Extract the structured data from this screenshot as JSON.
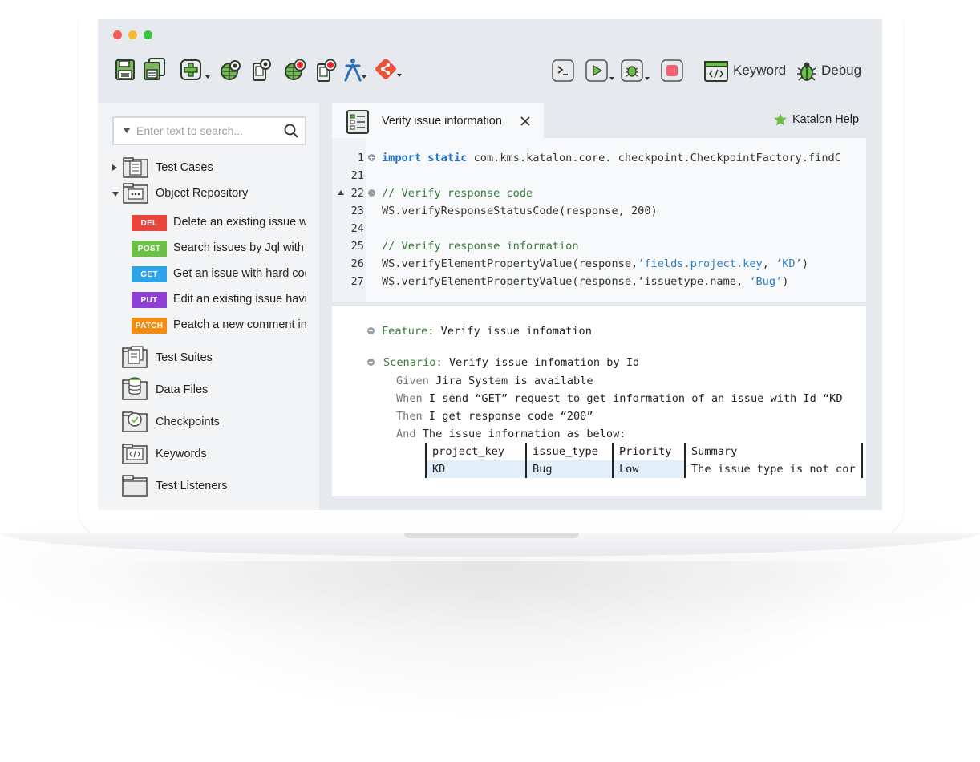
{
  "toolbar": {
    "keyword_label": "Keyword",
    "debug_label": "Debug"
  },
  "sidebar": {
    "search_placeholder": "Enter text to search...",
    "test_cases": "Test Cases",
    "object_repository": "Object Repository",
    "requests": [
      {
        "method": "DEL",
        "color": "#e8453c",
        "label": "Delete an existing issue wi"
      },
      {
        "method": "POST",
        "color": "#6cbf47",
        "label": "Search issues by Jql with"
      },
      {
        "method": "GET",
        "color": "#2ea3e8",
        "label": "Get an issue with hard cod"
      },
      {
        "method": "PUT",
        "color": "#8e3fd6",
        "label": "Edit an existing issue havir"
      },
      {
        "method": "PATCH",
        "color": "#f28c13",
        "label": "Peatch a new comment int"
      }
    ],
    "test_suites": "Test Suites",
    "data_files": "Data Files",
    "checkpoints": "Checkpoints",
    "keywords": "Keywords",
    "test_listeners": "Test Listeners"
  },
  "tab": {
    "title": "Verify issue information"
  },
  "help": {
    "label": "Katalon Help"
  },
  "code": {
    "line_numbers": [
      "1",
      "21",
      "22",
      "23",
      "24",
      "25",
      "26",
      "27"
    ],
    "l1_kw1": "import",
    "l1_kw2": "static",
    "l1_rest": " com.kms.katalon.core. checkpoint.CheckpointFactory.findC",
    "l22": "// Verify response code",
    "l23": "WS.verifyResponseStatusCode(response, 200)",
    "l25": "// Verify response information",
    "l26_a": "WS.verifyElementPropertyValue(response,",
    "l26_b": "’fields.project.key",
    "l26_c": ", ",
    "l26_d": "‘KD’",
    "l26_e": ")",
    "l27_a": "WS.verifyElementPropertyValue(response,’issuetype.name, ",
    "l27_b": "‘Bug’",
    "l27_c": ")"
  },
  "gherkin": {
    "feature_kw": "Feature:",
    "feature_text": " Verify issue infomation",
    "scenario_kw": "Scenario:",
    "scenario_text": " Verify issue infomation by Id",
    "given_kw": "Given",
    "given_text": " Jira System is available",
    "when_kw": "When",
    "when_text": " I send “GET” request to get information of an issue with Id “KD",
    "then_kw": "Then",
    "then_text": " I get response code “200”",
    "and_kw": "And",
    "and_text": " The issue information as below:",
    "table_header": [
      "project_key",
      "issue_type",
      "Priority",
      "Summary"
    ],
    "table_row": [
      "KD",
      "Bug",
      "Low",
      "The issue type is not cor"
    ]
  },
  "colors": {
    "accent_green": "#6cbf47",
    "code_blue": "#1f6fc2",
    "comment_green": "#3a7a3a"
  }
}
